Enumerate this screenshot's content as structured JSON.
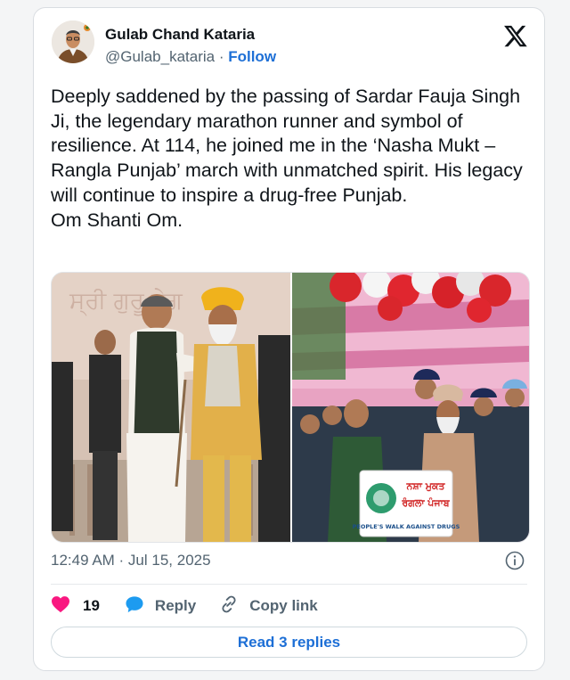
{
  "author": {
    "name": "Gulab Chand Kataria",
    "handle": "@Gulab_kataria",
    "separator": " · ",
    "follow_label": "Follow"
  },
  "tweet": {
    "text": "Deeply saddened by the passing of Sardar Fauja Singh Ji, the legendary marathon runner and symbol of resilience. At 114, he joined me in the ‘Nasha Mukt – Rangla Punjab’ march with unmatched spirit. His legacy will continue to inspire a drug-free Punjab.\nOm Shanti Om.",
    "timestamp": "12:49 AM · Jul 15, 2025"
  },
  "media": {
    "photo2_sign_line1": "ਨਸ਼ਾ ਮੁਕਤ",
    "photo2_sign_line2": "ਰੰਗਲਾ ਪੰਜਾਬ",
    "photo2_sign_caption": "PEOPLE'S WALK AGAINST DRUGS"
  },
  "actions": {
    "like_count": "19",
    "reply_label": "Reply",
    "copy_link_label": "Copy link",
    "read_replies_label": "Read 3 replies"
  },
  "colors": {
    "accent": "#1d6fd6",
    "like": "#f91880",
    "reply_bubble": "#1d9bf0",
    "muted": "#536471"
  },
  "icons": [
    "x-logo-icon",
    "info-icon",
    "heart-icon",
    "reply-bubble-icon",
    "link-icon"
  ]
}
